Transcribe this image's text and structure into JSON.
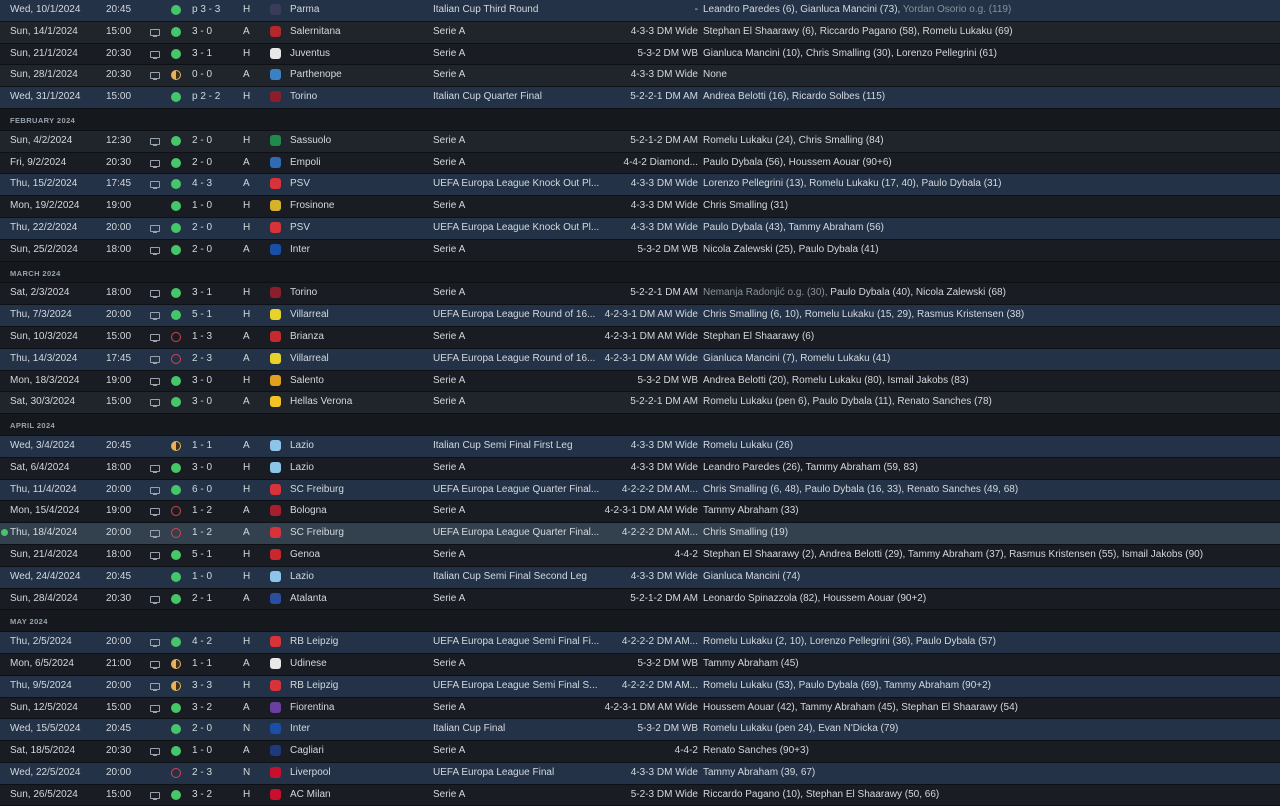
{
  "fixtures": [
    {
      "date": "Wed, 10/1/2024",
      "time": "20:45",
      "tv": false,
      "result": "win",
      "score": "p 3 - 3",
      "venue": "H",
      "crest_color": "#3a3d5a",
      "opponent": "Parma",
      "competition": "Italian Cup Third Round",
      "formation": "-",
      "scorers": "Leandro Paredes (6), Gianluca Mancini (73), ",
      "og_text": "Yordan Osorio o.g. (119)",
      "style": "europe"
    },
    {
      "date": "Sun, 14/1/2024",
      "time": "15:00",
      "tv": true,
      "result": "win",
      "score": "3 - 0",
      "venue": "A",
      "crest_color": "#b3272d",
      "opponent": "Salernitana",
      "competition": "Serie A",
      "formation": "4-3-3 DM Wide",
      "scorers": "Stephan El Shaarawy (6), Riccardo Pagano (58), Romelu Lukaku (69)",
      "style": "even"
    },
    {
      "date": "Sun, 21/1/2024",
      "time": "20:30",
      "tv": true,
      "result": "win",
      "score": "3 - 1",
      "venue": "H",
      "crest_color": "#e8e8e8",
      "opponent": "Juventus",
      "competition": "Serie A",
      "formation": "5-3-2 DM WB",
      "scorers": "Gianluca Mancini (10), Chris Smalling (30), Lorenzo Pellegrini (61)",
      "style": "odd"
    },
    {
      "date": "Sun, 28/1/2024",
      "time": "20:30",
      "tv": true,
      "result": "draw",
      "score": "0 - 0",
      "venue": "A",
      "crest_color": "#3b82c4",
      "opponent": "Parthenope",
      "competition": "Serie A",
      "formation": "4-3-3 DM Wide",
      "scorers": "None",
      "style": "even"
    },
    {
      "date": "Wed, 31/1/2024",
      "time": "15:00",
      "tv": false,
      "result": "win",
      "score": "p 2 - 2",
      "venue": "H",
      "crest_color": "#8b1e2b",
      "opponent": "Torino",
      "competition": "Italian Cup Quarter Final",
      "formation": "5-2-2-1 DM AM",
      "scorers": "Andrea Belotti (16), Ricardo Solbes (115)",
      "style": "europe"
    },
    {
      "header": "FEBRUARY 2024"
    },
    {
      "date": "Sun, 4/2/2024",
      "time": "12:30",
      "tv": true,
      "result": "win",
      "score": "2 - 0",
      "venue": "H",
      "crest_color": "#1f8a4c",
      "opponent": "Sassuolo",
      "competition": "Serie A",
      "formation": "5-2-1-2 DM AM",
      "scorers": "Romelu Lukaku (24), Chris Smalling (84)",
      "style": "even"
    },
    {
      "date": "Fri, 9/2/2024",
      "time": "20:30",
      "tv": true,
      "result": "win",
      "score": "2 - 0",
      "venue": "A",
      "crest_color": "#2f6bb3",
      "opponent": "Empoli",
      "competition": "Serie A",
      "formation": "4-4-2 Diamond...",
      "scorers": "Paulo Dybala (56), Houssem Aouar (90+6)",
      "style": "odd"
    },
    {
      "date": "Thu, 15/2/2024",
      "time": "17:45",
      "tv": true,
      "result": "win",
      "score": "4 - 3",
      "venue": "A",
      "crest_color": "#d6333a",
      "opponent": "PSV",
      "competition": "UEFA Europa League Knock Out Pl...",
      "formation": "4-3-3 DM Wide",
      "scorers": "Lorenzo Pellegrini (13), Romelu Lukaku (17, 40), Paulo Dybala (31)",
      "style": "europe"
    },
    {
      "date": "Mon, 19/2/2024",
      "time": "19:00",
      "tv": false,
      "result": "win",
      "score": "1 - 0",
      "venue": "H",
      "crest_color": "#d4b32a",
      "opponent": "Frosinone",
      "competition": "Serie A",
      "formation": "4-3-3 DM Wide",
      "scorers": "Chris Smalling (31)",
      "style": "odd"
    },
    {
      "date": "Thu, 22/2/2024",
      "time": "20:00",
      "tv": true,
      "result": "win",
      "score": "2 - 0",
      "venue": "H",
      "crest_color": "#d6333a",
      "opponent": "PSV",
      "competition": "UEFA Europa League Knock Out Pl...",
      "formation": "4-3-3 DM Wide",
      "scorers": "Paulo Dybala (43), Tammy Abraham (56)",
      "style": "europe"
    },
    {
      "date": "Sun, 25/2/2024",
      "time": "18:00",
      "tv": true,
      "result": "win",
      "score": "2 - 0",
      "venue": "A",
      "crest_color": "#1a4fa8",
      "opponent": "Inter",
      "competition": "Serie A",
      "formation": "5-3-2 DM WB",
      "scorers": "Nicola Zalewski (25), Paulo Dybala (41)",
      "style": "odd"
    },
    {
      "header": "MARCH 2024"
    },
    {
      "date": "Sat, 2/3/2024",
      "time": "18:00",
      "tv": true,
      "result": "win",
      "score": "3 - 1",
      "venue": "H",
      "crest_color": "#8b1e2b",
      "opponent": "Torino",
      "competition": "Serie A",
      "formation": "5-2-2-1 DM AM",
      "scorers": "Paulo Dybala (40), Nicola Zalewski (68)",
      "og_prefix": "Nemanja Radonjić o.g. (30), ",
      "style": "odd"
    },
    {
      "date": "Thu, 7/3/2024",
      "time": "20:00",
      "tv": true,
      "result": "win",
      "score": "5 - 1",
      "venue": "H",
      "crest_color": "#e8d32a",
      "opponent": "Villarreal",
      "competition": "UEFA Europa League Round of 16...",
      "formation": "4-2-3-1 DM AM Wide",
      "scorers": "Chris Smalling (6, 10), Romelu Lukaku (15, 29), Rasmus Kristensen (38)",
      "style": "europe"
    },
    {
      "date": "Sun, 10/3/2024",
      "time": "15:00",
      "tv": true,
      "result": "loss",
      "score": "1 - 3",
      "venue": "A",
      "crest_color": "#c7292f",
      "opponent": "Brianza",
      "competition": "Serie A",
      "formation": "4-2-3-1 DM AM Wide",
      "scorers": "Stephan El Shaarawy (6)",
      "style": "odd"
    },
    {
      "date": "Thu, 14/3/2024",
      "time": "17:45",
      "tv": true,
      "result": "loss",
      "score": "2 - 3",
      "venue": "A",
      "crest_color": "#e8d32a",
      "opponent": "Villarreal",
      "competition": "UEFA Europa League Round of 16...",
      "formation": "4-2-3-1 DM AM Wide",
      "scorers": "Gianluca Mancini (7), Romelu Lukaku (41)",
      "style": "europe"
    },
    {
      "date": "Mon, 18/3/2024",
      "time": "19:00",
      "tv": true,
      "result": "win",
      "score": "3 - 0",
      "venue": "H",
      "crest_color": "#e0a21e",
      "opponent": "Salento",
      "competition": "Serie A",
      "formation": "5-3-2 DM WB",
      "scorers": "Andrea Belotti (20), Romelu Lukaku (80), Ismail Jakobs (83)",
      "style": "odd"
    },
    {
      "date": "Sat, 30/3/2024",
      "time": "15:00",
      "tv": true,
      "result": "win",
      "score": "3 - 0",
      "venue": "A",
      "crest_color": "#f2c322",
      "opponent": "Hellas Verona",
      "competition": "Serie A",
      "formation": "5-2-2-1 DM AM",
      "scorers": "Romelu Lukaku (pen 6), Paulo Dybala (11), Renato Sanches (78)",
      "style": "even"
    },
    {
      "header": "APRIL 2024"
    },
    {
      "date": "Wed, 3/4/2024",
      "time": "20:45",
      "tv": false,
      "result": "draw",
      "score": "1 - 1",
      "venue": "A",
      "crest_color": "#8cc5e8",
      "opponent": "Lazio",
      "competition": "Italian Cup Semi Final First Leg",
      "formation": "4-3-3 DM Wide",
      "scorers": "Romelu Lukaku (26)",
      "style": "europe"
    },
    {
      "date": "Sat, 6/4/2024",
      "time": "18:00",
      "tv": true,
      "result": "win",
      "score": "3 - 0",
      "venue": "H",
      "crest_color": "#8cc5e8",
      "opponent": "Lazio",
      "competition": "Serie A",
      "formation": "4-3-3 DM Wide",
      "scorers": "Leandro Paredes (26), Tammy Abraham (59, 83)",
      "style": "odd"
    },
    {
      "date": "Thu, 11/4/2024",
      "time": "20:00",
      "tv": true,
      "result": "win",
      "score": "6 - 0",
      "venue": "H",
      "crest_color": "#d6333a",
      "opponent": "SC Freiburg",
      "competition": "UEFA Europa League Quarter Final...",
      "formation": "4-2-2-2 DM AM...",
      "scorers": "Chris Smalling (6, 48), Paulo Dybala (16, 33), Renato Sanches (49, 68)",
      "style": "europe"
    },
    {
      "date": "Mon, 15/4/2024",
      "time": "19:00",
      "tv": true,
      "result": "loss",
      "score": "1 - 2",
      "venue": "A",
      "crest_color": "#a51f2e",
      "opponent": "Bologna",
      "competition": "Serie A",
      "formation": "4-2-3-1 DM AM Wide",
      "scorers": "Tammy Abraham (33)",
      "style": "odd"
    },
    {
      "date": "Thu, 18/4/2024",
      "time": "20:00",
      "tv": true,
      "result": "loss",
      "score": "1 - 2",
      "venue": "A",
      "crest_color": "#d6333a",
      "opponent": "SC Freiburg",
      "competition": "UEFA Europa League Quarter Final...",
      "formation": "4-2-2-2 DM AM...",
      "scorers": "Chris Smalling (19)",
      "style": "selected"
    },
    {
      "date": "Sun, 21/4/2024",
      "time": "18:00",
      "tv": true,
      "result": "win",
      "score": "5 - 1",
      "venue": "H",
      "crest_color": "#c9262d",
      "opponent": "Genoa",
      "competition": "Serie A",
      "formation": "4-4-2",
      "scorers": "Stephan El Shaarawy (2), Andrea Belotti (29), Tammy Abraham (37), Rasmus Kristensen (55), Ismail Jakobs (90)",
      "style": "odd"
    },
    {
      "date": "Wed, 24/4/2024",
      "time": "20:45",
      "tv": false,
      "result": "win",
      "score": "1 - 0",
      "venue": "H",
      "crest_color": "#8cc5e8",
      "opponent": "Lazio",
      "competition": "Italian Cup Semi Final Second Leg",
      "formation": "4-3-3 DM Wide",
      "scorers": "Gianluca Mancini (74)",
      "style": "europe"
    },
    {
      "date": "Sun, 28/4/2024",
      "time": "20:30",
      "tv": true,
      "result": "win",
      "score": "2 - 1",
      "venue": "A",
      "crest_color": "#2a4f9e",
      "opponent": "Atalanta",
      "competition": "Serie A",
      "formation": "5-2-1-2 DM AM",
      "scorers": "Leonardo Spinazzola (82), Houssem Aouar (90+2)",
      "style": "odd"
    },
    {
      "header": "MAY 2024"
    },
    {
      "date": "Thu, 2/5/2024",
      "time": "20:00",
      "tv": true,
      "result": "win",
      "score": "4 - 2",
      "venue": "H",
      "crest_color": "#d6333a",
      "opponent": "RB Leipzig",
      "competition": "UEFA Europa League Semi Final Fi...",
      "formation": "4-2-2-2 DM AM...",
      "scorers": "Romelu Lukaku (2, 10), Lorenzo Pellegrini (36), Paulo Dybala (57)",
      "style": "europe"
    },
    {
      "date": "Mon, 6/5/2024",
      "time": "21:00",
      "tv": true,
      "result": "draw",
      "score": "1 - 1",
      "venue": "A",
      "crest_color": "#e8e8e8",
      "opponent": "Udinese",
      "competition": "Serie A",
      "formation": "5-3-2 DM WB",
      "scorers": "Tammy Abraham (45)",
      "style": "odd"
    },
    {
      "date": "Thu, 9/5/2024",
      "time": "20:00",
      "tv": true,
      "result": "draw",
      "score": "3 - 3",
      "venue": "H",
      "crest_color": "#d6333a",
      "opponent": "RB Leipzig",
      "competition": "UEFA Europa League Semi Final S...",
      "formation": "4-2-2-2 DM AM...",
      "scorers": "Romelu Lukaku (53), Paulo Dybala (69), Tammy Abraham (90+2)",
      "style": "europe"
    },
    {
      "date": "Sun, 12/5/2024",
      "time": "15:00",
      "tv": true,
      "result": "win",
      "score": "3 - 2",
      "venue": "A",
      "crest_color": "#6a3fa0",
      "opponent": "Fiorentina",
      "competition": "Serie A",
      "formation": "4-2-3-1 DM AM Wide",
      "scorers": "Houssem Aouar (42), Tammy Abraham (45), Stephan El Shaarawy (54)",
      "style": "odd"
    },
    {
      "date": "Wed, 15/5/2024",
      "time": "20:45",
      "tv": false,
      "result": "win",
      "score": "2 - 0",
      "venue": "N",
      "crest_color": "#1a4fa8",
      "opponent": "Inter",
      "competition": "Italian Cup Final",
      "formation": "5-3-2 DM WB",
      "scorers": "Romelu Lukaku (pen 24), Evan N'Dicka (79)",
      "style": "europe"
    },
    {
      "date": "Sat, 18/5/2024",
      "time": "20:30",
      "tv": true,
      "result": "win",
      "score": "1 - 0",
      "venue": "A",
      "crest_color": "#1e3a7a",
      "opponent": "Cagliari",
      "competition": "Serie A",
      "formation": "4-4-2",
      "scorers": "Renato Sanches (90+3)",
      "style": "odd"
    },
    {
      "date": "Wed, 22/5/2024",
      "time": "20:00",
      "tv": false,
      "result": "loss",
      "score": "2 - 3",
      "venue": "N",
      "crest_color": "#c8102e",
      "opponent": "Liverpool",
      "competition": "UEFA Europa League Final",
      "formation": "4-3-3 DM Wide",
      "scorers": "Tammy Abraham (39, 67)",
      "style": "europe"
    },
    {
      "date": "Sun, 26/5/2024",
      "time": "15:00",
      "tv": true,
      "result": "win",
      "score": "3 - 2",
      "venue": "H",
      "crest_color": "#c8102e",
      "opponent": "AC Milan",
      "competition": "Serie A",
      "formation": "5-2-3 DM Wide",
      "scorers": "Riccardo Pagano (10), Stephan El Shaarawy (50, 66)",
      "style": "odd"
    }
  ]
}
